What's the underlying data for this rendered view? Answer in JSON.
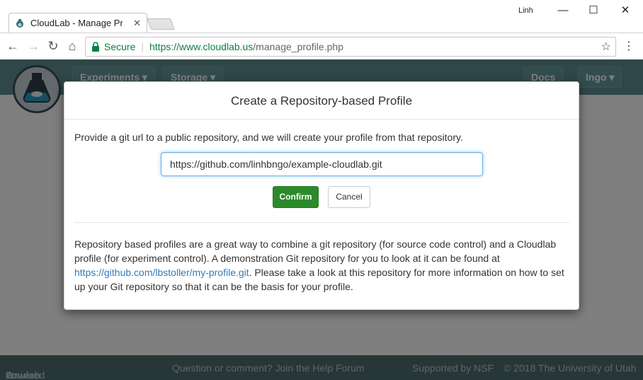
{
  "browser": {
    "tab_title": "CloudLab - Manage Prof",
    "user_name": "Linh",
    "secure_label": "Secure",
    "url_scheme_host": "https://www.cloudlab.us",
    "url_path": "/manage_profile.php"
  },
  "site": {
    "nav": {
      "experiments": "Experiments",
      "storage": "Storage",
      "docs": "Docs",
      "user_menu": "Ingo"
    },
    "footer": {
      "powered_by": "Powered by",
      "emulab": "emulab",
      "question": "Question or comment? Join the Help Forum",
      "supported": "Supported by NSF",
      "copyright": "© 2018 The University of Utah"
    }
  },
  "modal": {
    "title": "Create a Repository-based Profile",
    "prompt": "Provide a git url to a public repository, and we will create your profile from that repository.",
    "url_value": "https://github.com/linhbngo/example-cloudlab.git",
    "confirm_label": "Confirm",
    "cancel_label": "Cancel",
    "info_before": "Repository based profiles are a great way to combine a git repository (for source code control) and a Cloudlab profile (for experiment control). A demonstration Git repository for you to look at it can be found at ",
    "info_link": "https://github.com/lbstoller/my-profile.git",
    "info_after": ". Please take a look at this repository for more information on how to set up your Git repository so that it can be the basis for your profile."
  }
}
